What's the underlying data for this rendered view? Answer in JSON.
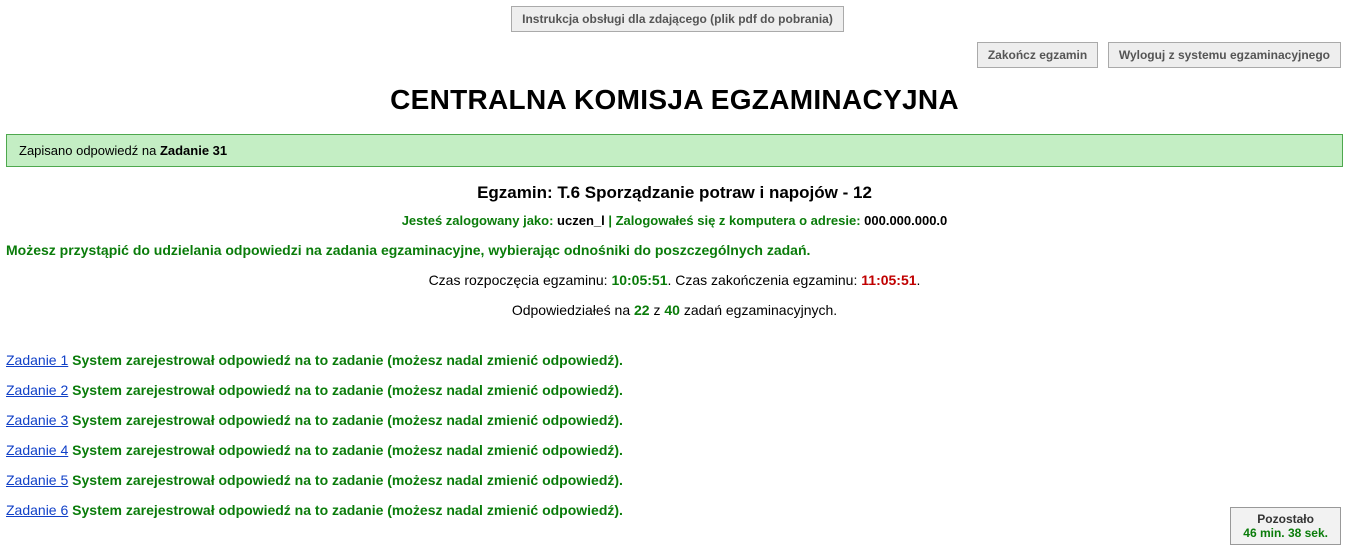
{
  "top": {
    "instructionButton": "Instrukcja obsługi dla zdającego (plik pdf do pobrania)",
    "finishExam": "Zakończ egzamin",
    "logout": "Wyloguj z systemu egzaminacyjnego"
  },
  "header": {
    "title": "CENTRALNA KOMISJA EGZAMINACYJNA"
  },
  "banner": {
    "prefix": "Zapisano odpowiedź na ",
    "taskRef": "Zadanie 31"
  },
  "exam": {
    "labelPrefix": "Egzamin: ",
    "name": "T.6 Sporządzanie potraw i napojów - 12"
  },
  "login": {
    "loggedAsLabel": "Jesteś zalogowany jako: ",
    "user": "uczen_l",
    "sep": " | ",
    "ipLabel": "Zalogowałeś się z komputera o adresie: ",
    "ip": " 000.000.000.0"
  },
  "instruction": "Możesz przystąpić do udzielania odpowiedzi na zadania egzaminacyjne, wybierając odnośniki do poszczególnych zadań.",
  "times": {
    "startLabel": "Czas rozpoczęcia egzaminu: ",
    "start": "10:05:51",
    "betweenDotSpace": ". ",
    "endLabel": "Czas zakończenia egzaminu: ",
    "end": "11:05:51",
    "trailingDot": "."
  },
  "answered": {
    "a": "Odpowiedziałeś na ",
    "done": "22",
    "b": " z ",
    "total": "40",
    "c": " zadań egzaminacyjnych."
  },
  "tasks": [
    {
      "label": "Zadanie 1",
      "status": "System zarejestrował odpowiedź na to zadanie (możesz nadal zmienić odpowiedź)."
    },
    {
      "label": "Zadanie 2",
      "status": "System zarejestrował odpowiedź na to zadanie (możesz nadal zmienić odpowiedź)."
    },
    {
      "label": "Zadanie 3",
      "status": "System zarejestrował odpowiedź na to zadanie (możesz nadal zmienić odpowiedź)."
    },
    {
      "label": "Zadanie 4",
      "status": "System zarejestrował odpowiedź na to zadanie (możesz nadal zmienić odpowiedź)."
    },
    {
      "label": "Zadanie 5",
      "status": "System zarejestrował odpowiedź na to zadanie (możesz nadal zmienić odpowiedź)."
    },
    {
      "label": "Zadanie 6",
      "status": "System zarejestrował odpowiedź na to zadanie (możesz nadal zmienić odpowiedź)."
    }
  ],
  "timer": {
    "label": "Pozostało",
    "value": "46 min. 38 sek."
  }
}
